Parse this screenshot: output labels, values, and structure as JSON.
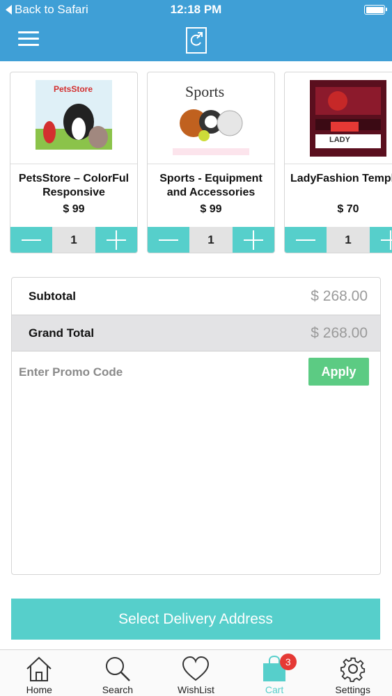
{
  "status_bar": {
    "back_label": "Back to Safari",
    "time": "12:18 PM"
  },
  "cart_items": [
    {
      "name": "PetsStore – ColorFul\nResponsive Magento…",
      "price": "$ 99",
      "quantity": "1",
      "brand_text": "PetsStore"
    },
    {
      "name": "Sports - Equipment\nand Accessories Mag…",
      "price": "$ 99",
      "quantity": "1",
      "brand_text": "Sports"
    },
    {
      "name": "LadyFashion Templa",
      "price": "$ 70",
      "quantity": "1",
      "brand_text": "LADY"
    }
  ],
  "summary": {
    "subtotal_label": "Subtotal",
    "subtotal_value": "$ 268.00",
    "grand_total_label": "Grand Total",
    "grand_total_value": "$ 268.00",
    "promo_placeholder": "Enter Promo Code",
    "apply_label": "Apply"
  },
  "cta": {
    "label": "Select Delivery Address"
  },
  "tabs": [
    {
      "label": "Home",
      "icon": "home-icon"
    },
    {
      "label": "Search",
      "icon": "search-icon"
    },
    {
      "label": "WishList",
      "icon": "heart-icon"
    },
    {
      "label": "Cart",
      "icon": "cart-bag-icon",
      "badge": "3",
      "active": true
    },
    {
      "label": "Settings",
      "icon": "gear-icon"
    }
  ],
  "colors": {
    "header": "#3f9fd6",
    "accent": "#56cfcb",
    "apply": "#5ccb83",
    "badge": "#e53935"
  }
}
